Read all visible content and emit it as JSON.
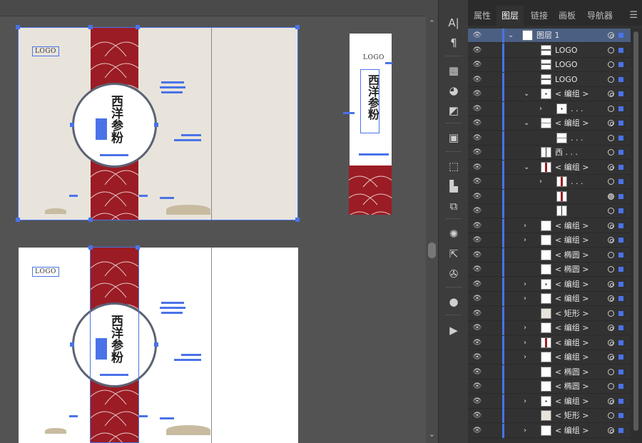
{
  "canvas": {
    "logo_text": "LOGO",
    "product_title": "西洋参粉",
    "colors": {
      "band": "#9b1c24",
      "artboard": "#e8e4dc",
      "selection": "#4a73e8"
    }
  },
  "toolbar": {
    "tools": [
      "character-icon",
      "paragraph-icon",
      "swatches-icon",
      "color-guide-icon",
      "gradient-icon",
      "transparency-icon",
      "transform-icon",
      "align-icon",
      "pathfinder-icon",
      "appearance-icon",
      "export-icon",
      "symbols-icon",
      "libraries-icon",
      "play-icon"
    ]
  },
  "panel": {
    "tabs": [
      {
        "label": "属性",
        "active": false
      },
      {
        "label": "图层",
        "active": true
      },
      {
        "label": "链接",
        "active": false
      },
      {
        "label": "画板",
        "active": false
      },
      {
        "label": "导航器",
        "active": false
      }
    ],
    "layers": [
      {
        "label": "图层 1",
        "indent": 0,
        "chev": "down",
        "highlight": true
      },
      {
        "label": "LOGO",
        "indent": 1,
        "chev": "",
        "thumb": "logo"
      },
      {
        "label": "LOGO",
        "indent": 1,
        "chev": "",
        "thumb": "logo"
      },
      {
        "label": "LOGO",
        "indent": 1,
        "chev": "",
        "thumb": "logo"
      },
      {
        "label": "< 编组 >",
        "indent": 1,
        "chev": "down",
        "thumb": "dot"
      },
      {
        "label": ". . .",
        "indent": 2,
        "chev": "right",
        "thumb": "dot"
      },
      {
        "label": "< 编组 >",
        "indent": 1,
        "chev": "down",
        "thumb": "line"
      },
      {
        "label": ". . .",
        "indent": 2,
        "chev": "",
        "thumb": "line"
      },
      {
        "label": "西 . . .",
        "indent": 1,
        "chev": "",
        "thumb": "text"
      },
      {
        "label": "< 编组 >",
        "indent": 1,
        "chev": "down",
        "thumb": "red"
      },
      {
        "label": ". . .",
        "indent": 2,
        "chev": "right",
        "thumb": "red"
      },
      {
        "label": "",
        "indent": 2,
        "chev": "",
        "thumb": "red"
      },
      {
        "label": "",
        "indent": 2,
        "chev": "",
        "thumb": "text"
      },
      {
        "label": "< 编组 >",
        "indent": 1,
        "chev": "right",
        "thumb": "blank"
      },
      {
        "label": "< 编组 >",
        "indent": 1,
        "chev": "right",
        "thumb": "blank"
      },
      {
        "label": "< 椭圆 >",
        "indent": 1,
        "chev": "",
        "thumb": "blank"
      },
      {
        "label": "< 椭圆 >",
        "indent": 1,
        "chev": "",
        "thumb": "blank"
      },
      {
        "label": "< 编组 >",
        "indent": 1,
        "chev": "right",
        "thumb": "dot"
      },
      {
        "label": "< 编组 >",
        "indent": 1,
        "chev": "right",
        "thumb": "blank"
      },
      {
        "label": "< 矩形 >",
        "indent": 1,
        "chev": "",
        "thumb": "beige"
      },
      {
        "label": "< 编组 >",
        "indent": 1,
        "chev": "right",
        "thumb": "blank"
      },
      {
        "label": "< 编组 >",
        "indent": 1,
        "chev": "right",
        "thumb": "red"
      },
      {
        "label": "< 编组 >",
        "indent": 1,
        "chev": "right",
        "thumb": "blank"
      },
      {
        "label": "< 椭圆 >",
        "indent": 1,
        "chev": "",
        "thumb": "blank"
      },
      {
        "label": "< 椭圆 >",
        "indent": 1,
        "chev": "",
        "thumb": "blank"
      },
      {
        "label": "< 编组 >",
        "indent": 1,
        "chev": "right",
        "thumb": "dot"
      },
      {
        "label": "< 矩形 >",
        "indent": 1,
        "chev": "",
        "thumb": "beige"
      },
      {
        "label": "< 编组 >",
        "indent": 1,
        "chev": "right",
        "thumb": "blank"
      }
    ]
  }
}
